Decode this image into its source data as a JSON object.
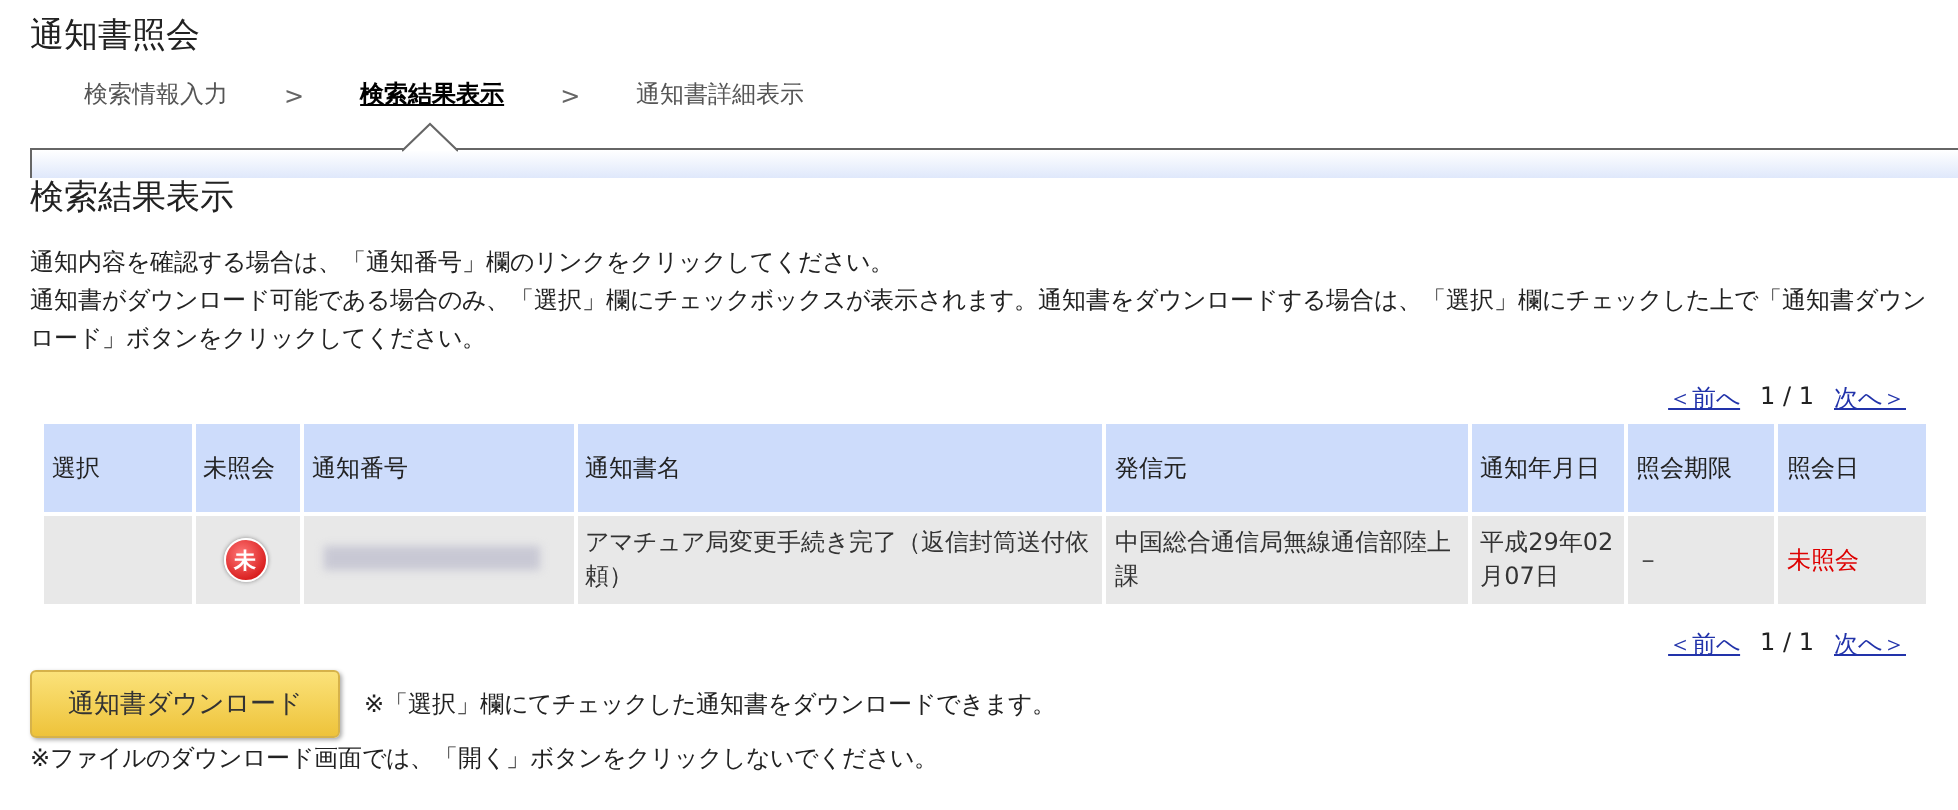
{
  "page_title": "通知書照会",
  "steps": [
    {
      "label": "検索情報入力",
      "selected": false
    },
    {
      "label": "検索結果表示",
      "selected": true
    },
    {
      "label": "通知書詳細表示",
      "selected": false
    }
  ],
  "step_separator": ">",
  "section_title": "検索結果表示",
  "instructions": [
    "通知内容を確認する場合は、「通知番号」欄のリンクをクリックしてください。",
    "通知書がダウンロード可能である場合のみ、「選択」欄にチェックボックスが表示されます。通知書をダウンロードする場合は、「選択」欄にチェックした上で「通知書ダウンロード」ボタンをクリックしてください。"
  ],
  "pager_top": {
    "prev": "＜前へ",
    "page": "1 / 1",
    "next": "次へ＞"
  },
  "table": {
    "columns": [
      "選択",
      "未照会",
      "通知番号",
      "通知書名",
      "発信元",
      "通知年月日",
      "照会期限",
      "照会日"
    ],
    "rows": [
      {
        "unread": true,
        "unread_badge": "未",
        "number_redacted": true,
        "title": "アマチュア局変更手続き完了（返信封筒送付依頼）",
        "sender": "中国総合通信局無線通信部陸上課",
        "date": "平成29年02月07日",
        "deadline": "－",
        "viewed": "未照会"
      }
    ]
  },
  "pager_bottom": {
    "prev": "＜前へ",
    "page": "1 / 1",
    "next": "次へ＞"
  },
  "download_button": "通知書ダウンロード",
  "download_note": "※「選択」欄にてチェックした通知書をダウンロードできます。",
  "footer_note": "※ファイルのダウンロード画面では、「開く」ボタンをクリックしないでください。"
}
